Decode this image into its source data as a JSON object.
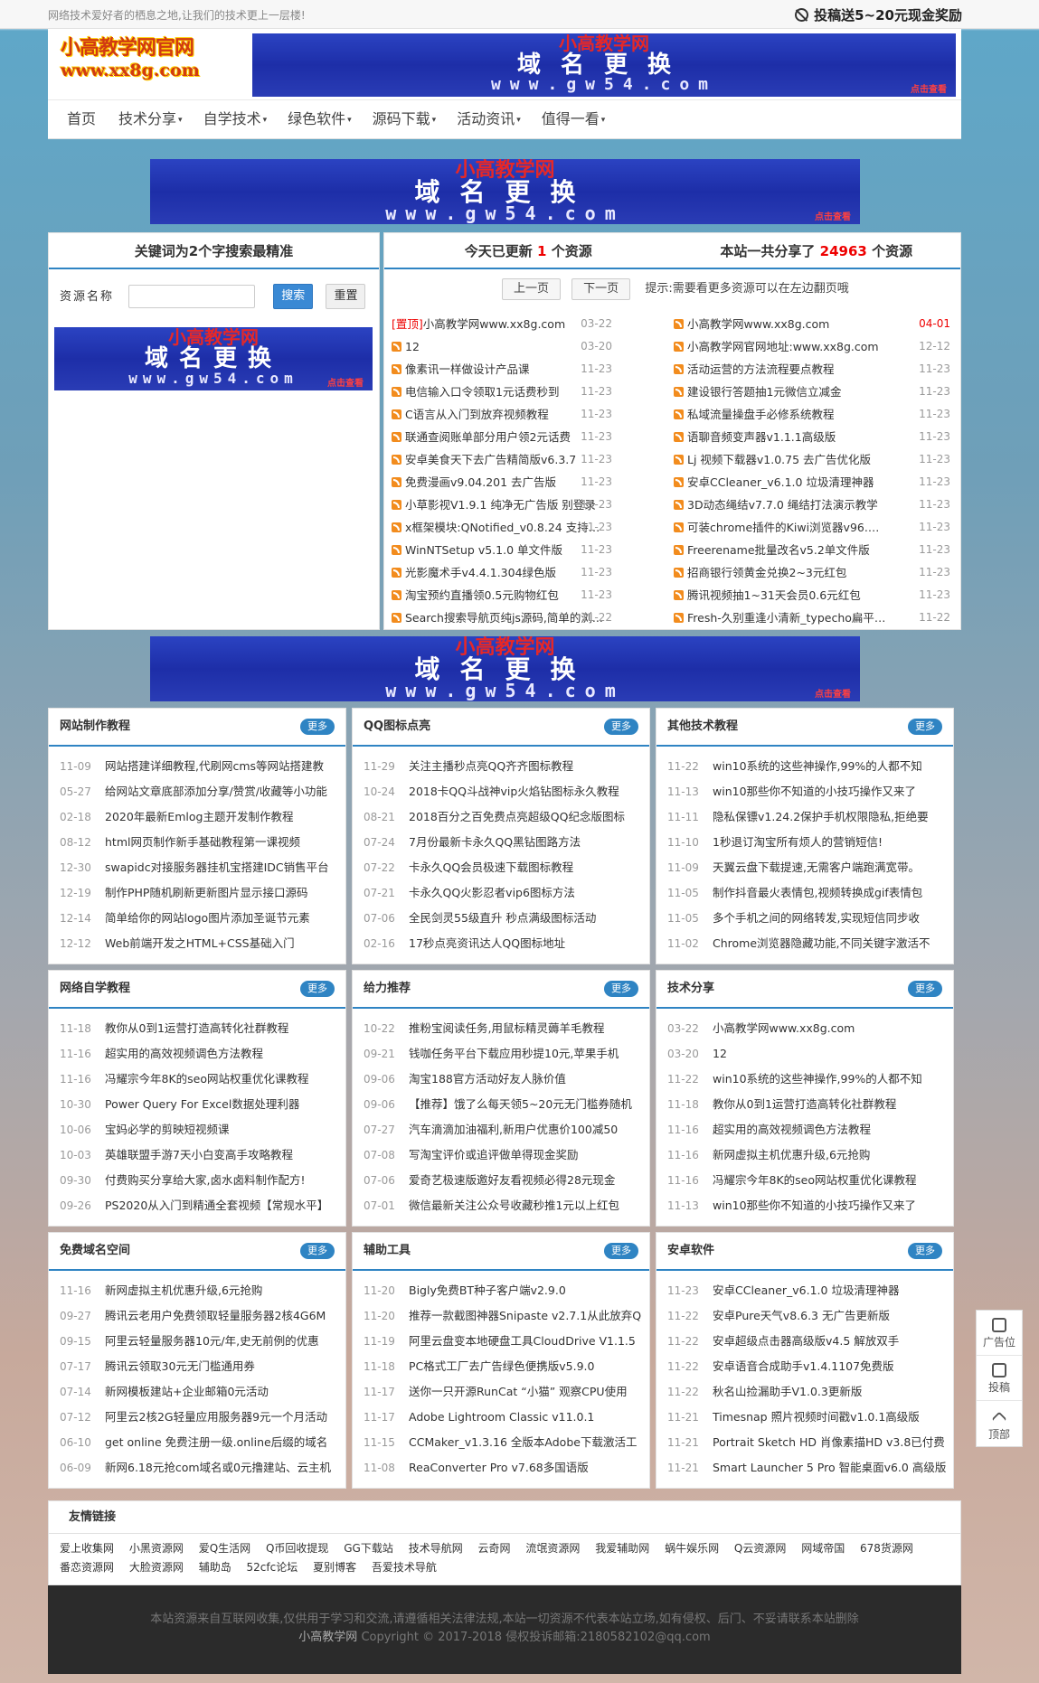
{
  "topbar": {
    "slogan": "网络技术爱好者的栖息之地,让我们的技术更上一层楼!",
    "reward": "投稿送5~20元现金奖励"
  },
  "logo": {
    "line1": "小高教学网官网",
    "line2": "www.xx8g.com"
  },
  "banner": {
    "line1": "小高教学网",
    "line2": "域名更换",
    "line3": "www.gw54.com",
    "tag": "点击查看"
  },
  "nav": [
    {
      "label": "首页",
      "caret": ""
    },
    {
      "label": "技术分享",
      "caret": "▾"
    },
    {
      "label": "自学技术",
      "caret": "▾"
    },
    {
      "label": "绿色软件",
      "caret": "▾"
    },
    {
      "label": "源码下载",
      "caret": "▾"
    },
    {
      "label": "活动资讯",
      "caret": "▾"
    },
    {
      "label": "值得一看",
      "caret": "▾"
    }
  ],
  "search": {
    "title": "关键词为2个字搜索最精准",
    "label": "资源名称",
    "submit": "搜索",
    "reset": "重置"
  },
  "stats": {
    "today_pre": "今天已更新",
    "today_count": "1",
    "today_post": "个资源",
    "total_pre": "本站一共分享了",
    "total_count": "24963",
    "total_post": "个资源",
    "prev": "上一页",
    "next": "下一页",
    "tip": "提示:需要看更多资源可以在左边翻页哦"
  },
  "resources_left": [
    {
      "top": "[置顶]",
      "title": "小高教学网www.xx8g.com",
      "date": "03-22"
    },
    {
      "top": "",
      "title": "12",
      "date": "03-20"
    },
    {
      "top": "",
      "title": "像素讯一样做设计产品课",
      "date": "11-23"
    },
    {
      "top": "",
      "title": "电信输入口令领取1元话费秒到",
      "date": "11-23"
    },
    {
      "top": "",
      "title": "C语言从入门到放弃视频教程",
      "date": "11-23"
    },
    {
      "top": "",
      "title": "联通查阅账单部分用户领2元话费",
      "date": "11-23"
    },
    {
      "top": "",
      "title": "安卓美食天下去广告精简版v6.3.7",
      "date": "11-23"
    },
    {
      "top": "",
      "title": "免费漫画v9.04.201 去广告版",
      "date": "11-23"
    },
    {
      "top": "",
      "title": "小草影视V1.9.1 纯净无广告版 别登录",
      "date": "11-23"
    },
    {
      "top": "",
      "title": "x框架模块:QNotified_v0.8.24 支持x...",
      "date": "11-23"
    },
    {
      "top": "",
      "title": "WinNTSetup v5.1.0 单文件版",
      "date": "11-23"
    },
    {
      "top": "",
      "title": "光影魔术手v4.4.1.304绿色版",
      "date": "11-23"
    },
    {
      "top": "",
      "title": "淘宝预约直播领0.5元购物红包",
      "date": "11-23"
    },
    {
      "top": "",
      "title": "Search搜索导航页纯js源码,简单的浏...",
      "date": "11-22"
    }
  ],
  "resources_right": [
    {
      "title": "小高教学网www.xx8g.com",
      "date": "04-01",
      "red": true
    },
    {
      "title": "小高教学网官网地址:www.xx8g.com",
      "date": "12-12",
      "red": false
    },
    {
      "title": "活动运营的方法流程要点教程",
      "date": "11-23",
      "red": false
    },
    {
      "title": "建设银行答题抽1元微信立减金",
      "date": "11-23",
      "red": false
    },
    {
      "title": "私域流量操盘手必修系统教程",
      "date": "11-23",
      "red": false
    },
    {
      "title": "语聊音频变声器v1.1.1高级版",
      "date": "11-23",
      "red": false
    },
    {
      "title": "Lj 视频下载器v1.0.75 去广告优化版",
      "date": "11-23",
      "red": false
    },
    {
      "title": "安卓CCleaner_v6.1.0 垃圾清理神器",
      "date": "11-23",
      "red": false
    },
    {
      "title": "3D动态绳结v7.7.0 绳结打法演示教学",
      "date": "11-23",
      "red": false
    },
    {
      "title": "可装chrome插件的Kiwi浏览器v96.0.4...",
      "date": "11-23",
      "red": false
    },
    {
      "title": "Freerename批量改名v5.2单文件版",
      "date": "11-23",
      "red": false
    },
    {
      "title": "招商银行领黄金兑换2~3元红包",
      "date": "11-23",
      "red": false
    },
    {
      "title": "腾讯视频抽1~31天会员0.6元红包",
      "date": "11-23",
      "red": false
    },
    {
      "title": "Fresh-久别重逢小清新_typecho扁平化...",
      "date": "11-22",
      "red": false
    }
  ],
  "more_label": "更多",
  "boxes": [
    {
      "title": "网站制作教程",
      "items": [
        {
          "d": "11-09",
          "t": "网站搭建详细教程,代刷网cms等网站搭建教"
        },
        {
          "d": "05-27",
          "t": "给网站文章底部添加分享/赞赏/收藏等小功能"
        },
        {
          "d": "02-18",
          "t": "2020年最新Emlog主题开发制作教程"
        },
        {
          "d": "08-12",
          "t": "html网页制作新手基础教程第一课视频"
        },
        {
          "d": "12-30",
          "t": "swapidc对接服务器挂机宝搭建IDC销售平台"
        },
        {
          "d": "12-19",
          "t": "制作PHP随机刷新更新图片显示接口源码"
        },
        {
          "d": "12-14",
          "t": "简单给你的网站logo图片添加圣诞节元素"
        },
        {
          "d": "12-12",
          "t": "Web前端开发之HTML+CSS基础入门"
        }
      ]
    },
    {
      "title": "QQ图标点亮",
      "items": [
        {
          "d": "11-29",
          "t": "关注主播秒点亮QQ齐齐图标教程"
        },
        {
          "d": "10-24",
          "t": "2018卡QQ斗战神vip火焰钻图标永久教程"
        },
        {
          "d": "08-21",
          "t": "2018百分之百免费点亮超级QQ纪念版图标"
        },
        {
          "d": "07-24",
          "t": "7月份最新卡永久QQ黑钻图路方法"
        },
        {
          "d": "07-22",
          "t": "卡永久QQ会员极速下载图标教程"
        },
        {
          "d": "07-21",
          "t": "卡永久QQ火影忍者vip6图标方法"
        },
        {
          "d": "07-06",
          "t": "全民剑灵55级直升 秒点满级图标活动"
        },
        {
          "d": "02-16",
          "t": "17秒点亮资讯达人QQ图标地址"
        }
      ]
    },
    {
      "title": "其他技术教程",
      "items": [
        {
          "d": "11-22",
          "t": "win10系统的这些神操作,99%的人都不知"
        },
        {
          "d": "11-13",
          "t": "win10那些你不知道的小技巧操作又来了"
        },
        {
          "d": "11-11",
          "t": "隐私保镖v1.24.2保护手机权限隐私,拒绝要"
        },
        {
          "d": "11-10",
          "t": "1秒退订淘宝所有烦人的营销短信!"
        },
        {
          "d": "11-09",
          "t": "天翼云盘下载提速,无需客户端跑满宽带。"
        },
        {
          "d": "11-05",
          "t": "制作抖音最火表情包,视频转换成gif表情包"
        },
        {
          "d": "11-05",
          "t": "多个手机之间的网络转发,实现短信同步收"
        },
        {
          "d": "11-02",
          "t": "Chrome浏览器隐藏功能,不同关键字激活不"
        }
      ]
    },
    {
      "title": "网络自学教程",
      "items": [
        {
          "d": "11-18",
          "t": "教你从0到1运营打造高转化社群教程"
        },
        {
          "d": "11-16",
          "t": "超实用的高效视频调色方法教程"
        },
        {
          "d": "11-16",
          "t": "冯耀宗今年8K的seo网站权重优化课教程"
        },
        {
          "d": "10-30",
          "t": "Power Query For Excel数据处理利器"
        },
        {
          "d": "10-06",
          "t": "宝妈必学的剪映短视频课"
        },
        {
          "d": "10-03",
          "t": "英雄联盟手游7天小白变高手攻略教程"
        },
        {
          "d": "09-30",
          "t": "付费购买分享给大家,卤水卤料制作配方!"
        },
        {
          "d": "09-26",
          "t": "PS2020从入门到精通全套视频【常规水平】"
        }
      ]
    },
    {
      "title": "给力推荐",
      "items": [
        {
          "d": "10-22",
          "t": "推粉宝阅读任务,用鼠标精灵薅羊毛教程"
        },
        {
          "d": "09-21",
          "t": "钱咖任务平台下载应用秒提10元,苹果手机"
        },
        {
          "d": "09-06",
          "t": "淘宝188官方活动好友人脉价值"
        },
        {
          "d": "09-06",
          "t": "【推荐】饿了么每天领5~20元无门槛券随机"
        },
        {
          "d": "07-27",
          "t": "汽车滴滴加油福利,新用户优惠价100减50"
        },
        {
          "d": "07-08",
          "t": "写淘宝评价或追评做单得现金奖励"
        },
        {
          "d": "07-06",
          "t": "爱奇艺极速版邀好友看视频必得28元现金"
        },
        {
          "d": "07-01",
          "t": "微信最新关注公众号收藏秒推1元以上红包"
        }
      ]
    },
    {
      "title": "技术分享",
      "items": [
        {
          "d": "03-22",
          "t": "小高教学网www.xx8g.com"
        },
        {
          "d": "03-20",
          "t": "12"
        },
        {
          "d": "11-22",
          "t": "win10系统的这些神操作,99%的人都不知"
        },
        {
          "d": "11-18",
          "t": "教你从0到1运营打造高转化社群教程"
        },
        {
          "d": "11-16",
          "t": "超实用的高效视频调色方法教程"
        },
        {
          "d": "11-16",
          "t": "新网虚拟主机优惠升级,6元抢购"
        },
        {
          "d": "11-16",
          "t": "冯耀宗今年8K的seo网站权重优化课教程"
        },
        {
          "d": "11-13",
          "t": "win10那些你不知道的小技巧操作又来了"
        }
      ]
    },
    {
      "title": "免费域名空间",
      "items": [
        {
          "d": "11-16",
          "t": "新网虚拟主机优惠升级,6元抢购"
        },
        {
          "d": "09-27",
          "t": "腾讯云老用户免费领取轻量服务器2核4G6M"
        },
        {
          "d": "09-15",
          "t": "阿里云轻量服务器10元/年,史无前例的优惠"
        },
        {
          "d": "07-17",
          "t": "腾讯云领取30元无门槛通用券"
        },
        {
          "d": "07-14",
          "t": "新网模板建站+企业邮箱0元活动"
        },
        {
          "d": "07-12",
          "t": "阿里云2核2G轻量应用服务器9元一个月活动"
        },
        {
          "d": "06-10",
          "t": "get online 免费注册一级.online后缀的域名"
        },
        {
          "d": "06-09",
          "t": "新网6.18元抢com域名或0元撸建站、云主机"
        }
      ]
    },
    {
      "title": "辅助工具",
      "items": [
        {
          "d": "11-20",
          "t": "Bigly免费BT种子客户端v2.9.0"
        },
        {
          "d": "11-20",
          "t": "推荐一款截图神器Snipaste v2.7.1从此放弃Q"
        },
        {
          "d": "11-19",
          "t": "阿里云盘变本地硬盘工具CloudDrive V1.1.5"
        },
        {
          "d": "11-18",
          "t": "PC格式工厂去广告绿色便携版v5.9.0"
        },
        {
          "d": "11-17",
          "t": "送你一只开源RunCat “小猫” 观察CPU使用"
        },
        {
          "d": "11-17",
          "t": "Adobe Lightroom Classic v11.0.1"
        },
        {
          "d": "11-15",
          "t": "CCMaker_v1.3.16 全版本Adobe下载激活工"
        },
        {
          "d": "11-08",
          "t": "ReaConverter Pro v7.68多国语版"
        }
      ]
    },
    {
      "title": "安卓软件",
      "items": [
        {
          "d": "11-23",
          "t": "安卓CCleaner_v6.1.0 垃圾清理神器"
        },
        {
          "d": "11-22",
          "t": "安卓Pure天气v8.6.3 无广告更新版"
        },
        {
          "d": "11-22",
          "t": "安卓超级点击器高级版v4.5 解放双手"
        },
        {
          "d": "11-22",
          "t": "安卓语音合成助手v1.4.1107免费版"
        },
        {
          "d": "11-22",
          "t": "秋名山捡漏助手V1.0.3更新版"
        },
        {
          "d": "11-21",
          "t": "Timesnap 照片视频时间戳v1.0.1高级版"
        },
        {
          "d": "11-21",
          "t": "Portrait Sketch HD 肖像素描HD v3.8已付费"
        },
        {
          "d": "11-21",
          "t": "Smart Launcher 5 Pro 智能桌面v6.0 高级版"
        }
      ]
    }
  ],
  "links": {
    "title": "友情链接",
    "items": [
      "爱上收集网",
      "小黑资源网",
      "爱Q生活网",
      "Q币回收提现",
      "GG下载站",
      "技术导航网",
      "云奇网",
      "流氓资源网",
      "我爱辅助网",
      "蜗牛娱乐网",
      "Q云资源网",
      "网域帝国",
      "678货源网",
      "番恋资源网",
      "大脸资源网",
      "辅助岛",
      "52cfc论坛",
      "夏别博客",
      "吾爱技术导航"
    ]
  },
  "footer": {
    "line1": "本站资源来自互联网收集,仅供用于学习和交流,请遵循相关法律法规,本站一切资源不代表本站立场,如有侵权、后门、不妥请联系本站删除",
    "name": "小高教学网",
    "line2": "Copyright © 2017-2018 侵权投诉邮箱:2180582102@qq.com"
  },
  "side": {
    "ad": "广告位",
    "submit": "投稿",
    "top": "顶部"
  }
}
